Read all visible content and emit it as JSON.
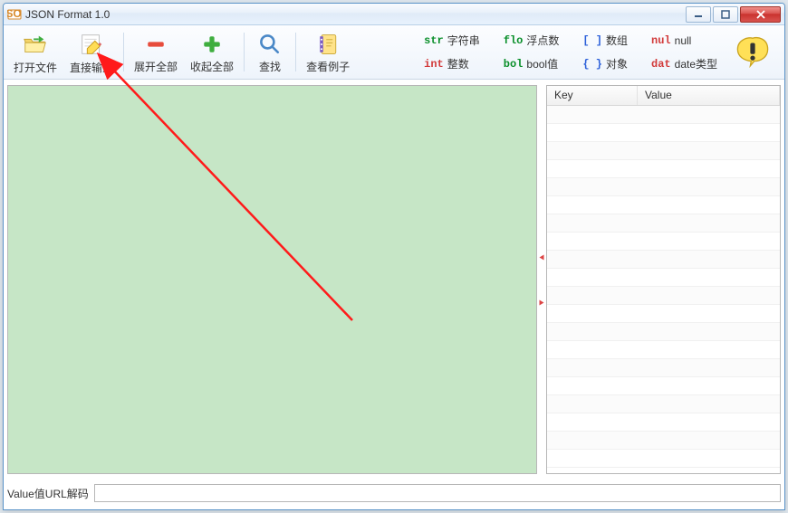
{
  "window": {
    "title": "JSON Format 1.0"
  },
  "toolbar": {
    "open_label": "打开文件",
    "input_label": "直接输入",
    "expand_label": "展开全部",
    "collapse_label": "收起全部",
    "find_label": "查找",
    "example_label": "查看例子"
  },
  "legend": {
    "str": {
      "tag": "str",
      "label": "字符串",
      "color": "#0a8f2a"
    },
    "flo": {
      "tag": "flo",
      "label": "浮点数",
      "color": "#0a8f2a"
    },
    "arr": {
      "tag": "[ ]",
      "label": "数组",
      "color": "#2b5fd9"
    },
    "nul": {
      "tag": "nul",
      "label": "null",
      "color": "#d23a3a"
    },
    "int": {
      "tag": "int",
      "label": "整数",
      "color": "#d23a3a"
    },
    "bol": {
      "tag": "bol",
      "label": "bool值",
      "color": "#0a8f2a"
    },
    "obj": {
      "tag": "{ }",
      "label": "对象",
      "color": "#2b5fd9"
    },
    "dat": {
      "tag": "dat",
      "label": "date类型",
      "color": "#d23a3a"
    }
  },
  "grid": {
    "col_key": "Key",
    "col_value": "Value",
    "rows": [
      "",
      "",
      "",
      "",
      "",
      "",
      "",
      "",
      "",
      "",
      "",
      "",
      "",
      "",
      "",
      "",
      "",
      "",
      "",
      ""
    ]
  },
  "bottom": {
    "label": "Value值URL解码",
    "value": ""
  }
}
